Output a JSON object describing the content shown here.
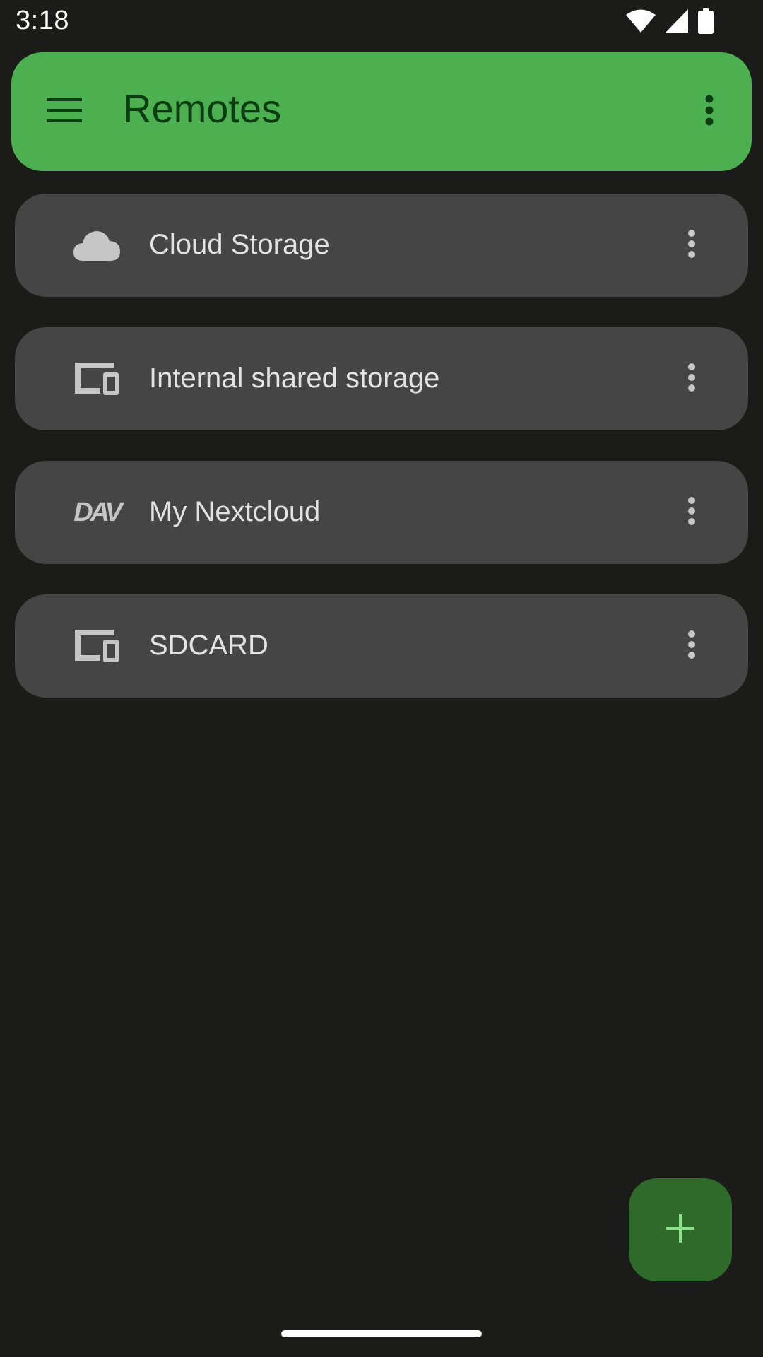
{
  "status_bar": {
    "time": "3:18",
    "icons": [
      "wifi-icon",
      "cell-signal-icon",
      "battery-icon"
    ]
  },
  "app_bar": {
    "title": "Remotes",
    "menu_icon": "hamburger-menu-icon",
    "overflow_icon": "more-vert-icon",
    "background_color": "#4caf50",
    "title_color": "#0c3d12"
  },
  "remotes": [
    {
      "label": "Cloud Storage",
      "icon": "cloud-icon"
    },
    {
      "label": "Internal shared storage",
      "icon": "devices-icon"
    },
    {
      "label": "My Nextcloud",
      "icon": "webdav-icon",
      "icon_text": "DAV"
    },
    {
      "label": "SDCARD",
      "icon": "devices-icon"
    }
  ],
  "fab": {
    "icon": "plus-icon",
    "background_color": "#2e6b2a",
    "icon_color": "#8ce28a"
  },
  "colors": {
    "background": "#1b1c1a",
    "card": "#454545",
    "card_text": "#e3e3e3",
    "icon": "#c6c6c6"
  }
}
